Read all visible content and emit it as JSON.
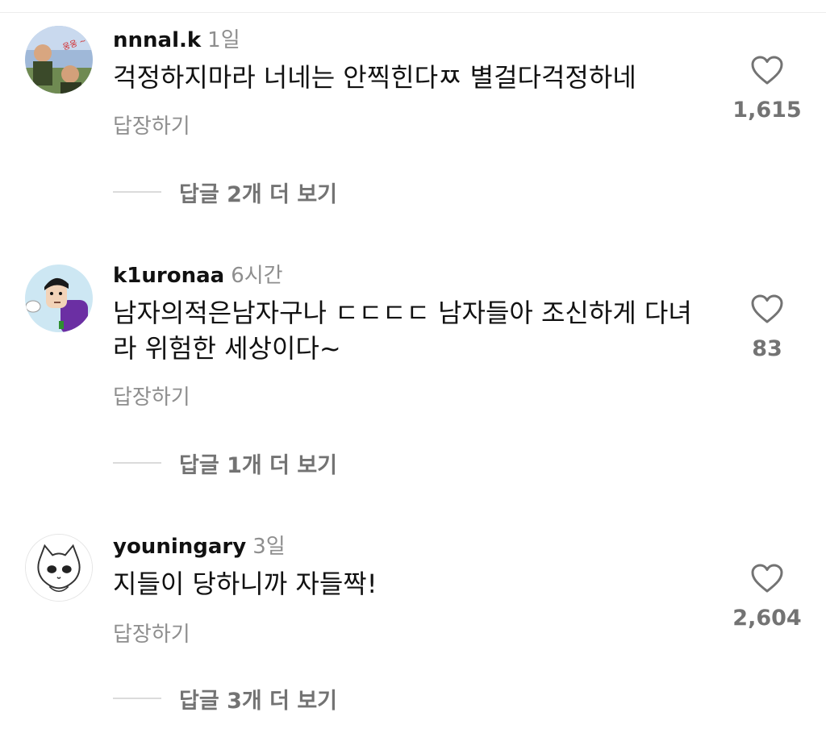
{
  "comments": [
    {
      "username": "nnnal.k",
      "time": "1일",
      "text": "걱정하지마라 너네는 안찍힌다ㅉ 별걸다걱정하네",
      "likes": "1,615",
      "reply_label": "답장하기",
      "more_replies": "답글 2개 더 보기",
      "avatar_text": "웅웅 ~"
    },
    {
      "username": "k1uronaa",
      "time": "6시간",
      "text": "남자의적은남자구나 ㄷㄷㄷㄷ 남자들아 조신하게 다녀라 위험한 세상이다~",
      "likes": "83",
      "reply_label": "답장하기",
      "more_replies": "답글 1개 더 보기"
    },
    {
      "username": "youningary",
      "time": "3일",
      "text": "지들이 당하니까 자들짝!",
      "likes": "2,604",
      "reply_label": "답장하기",
      "more_replies": "답글 3개 더 보기"
    }
  ],
  "icons": {
    "like": "heart-outline-icon"
  },
  "colors": {
    "secondary_text": "#8e8e8e",
    "count_text": "#737373",
    "divider": "#dbdbdb"
  }
}
